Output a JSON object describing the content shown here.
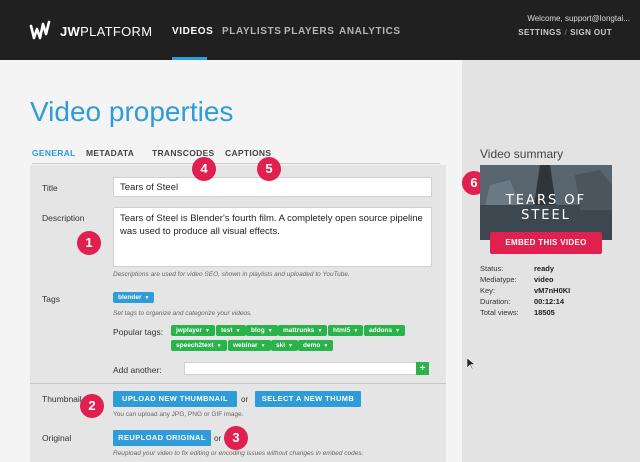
{
  "header": {
    "brand_bold": "JW",
    "brand_rest": "PLATFORM",
    "nav": [
      {
        "label": "VIDEOS",
        "active": true
      },
      {
        "label": "PLAYLISTS",
        "active": false
      },
      {
        "label": "PLAYERS",
        "active": false
      },
      {
        "label": "ANALYTICS",
        "active": false
      }
    ],
    "welcome": "Welcome, support@longtai...",
    "settings": "SETTINGS",
    "separator": "/",
    "signout": "SIGN OUT"
  },
  "page": {
    "title": "Video properties",
    "tabs": [
      "GENERAL",
      "METADATA",
      "TRANSCODES",
      "CAPTIONS"
    ],
    "active_tab": "GENERAL"
  },
  "form": {
    "title_label": "Title",
    "title_value": "Tears of Steel",
    "description_label": "Description",
    "description_value": "Tears of Steel is Blender's fourth film. A completely open source pipeline was used to produce all visual effects.",
    "description_hint": "Descriptions are used for video SEO, shown in playlists and uploaded to YouTube.",
    "tags_label": "Tags",
    "current_tag": "blender",
    "tags_hint": "Set tags to organize and categorize your videos.",
    "popular_tags_label": "Popular tags:",
    "popular_tags": [
      "jwplayer",
      "test",
      "blog",
      "mattrunks",
      "html5",
      "addons",
      "speech2text",
      "webinar",
      "ski",
      "demo"
    ],
    "add_another_label": "Add another:",
    "add_button": "+",
    "thumbnail_label": "Thumbnail",
    "upload_thumb_button": "UPLOAD NEW THUMBNAIL",
    "or_text": "or",
    "select_thumb_button": "SELECT A NEW THUMB",
    "thumb_hint": "You can upload any JPG, PNG or GIF image.",
    "original_label": "Original",
    "reupload_button": "REUPLOAD ORIGINAL",
    "or_text2": "or",
    "original_hint": "Reupload your video to fix editing or encoding issues without changes in embed codes."
  },
  "badges": [
    "1",
    "2",
    "3",
    "4",
    "5",
    "6"
  ],
  "summary": {
    "title": "Video summary",
    "thumb_text": "TEARS OF STEEL",
    "embed_button": "EMBED THIS VIDEO",
    "rows": [
      {
        "key": "Status:",
        "value": "ready"
      },
      {
        "key": "Mediatype:",
        "value": "video"
      },
      {
        "key": "Key:",
        "value": "vM7nH0KI"
      },
      {
        "key": "Duration:",
        "value": "00:12:14"
      },
      {
        "key": "Total views:",
        "value": "18505"
      }
    ]
  },
  "colors": {
    "header_bg": "#202020",
    "accent_blue": "#2e9cd8",
    "tag_green": "#2ab24b",
    "badge_red": "#e0204e",
    "embed_red": "#e0204e"
  }
}
